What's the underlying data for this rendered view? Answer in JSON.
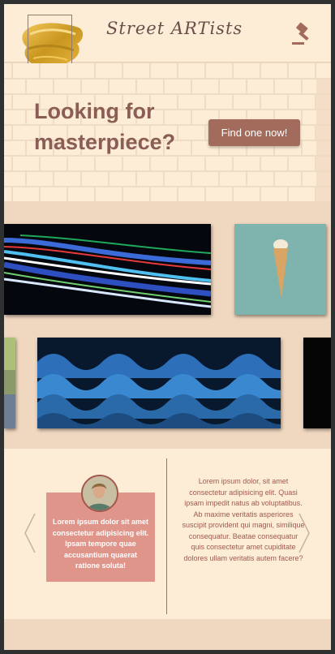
{
  "header": {
    "brand": "Street ARTists",
    "logo_icon": "paint-brush-stroke-logo",
    "action_icon": "gavel-icon"
  },
  "hero": {
    "title": "Looking for masterpiece?",
    "cta_label": "Find one now!"
  },
  "gallery": {
    "items": [
      {
        "name": "light-trails-artwork"
      },
      {
        "name": "ice-cream-cone-artwork"
      },
      {
        "name": "landscape-artwork-partial"
      },
      {
        "name": "blue-waves-artwork"
      },
      {
        "name": "dark-artwork-partial"
      }
    ]
  },
  "testimonials": {
    "prev_icon": "chevron-left-icon",
    "next_icon": "chevron-right-icon",
    "card_quote": "Lorem ipsum dolor sit amet consectetur adipisicing elit. Ipsam tempore quae accusantium quaerat ratione soluta!",
    "side_quote": "Lorem ipsum dolor, sit amet consectetur adipisicing elit. Quasi ipsam impedit natus ab voluptatibus. Ab maxime veritatis asperiores suscipit provident qui magni, similique consequatur. Beatae consequatur quis consectetur amet cupiditate dolores ullam veritatis autem facere?"
  },
  "colors": {
    "page_bg": "#f0d8c0",
    "header_bg": "#fdecd6",
    "accent": "#a36b5c",
    "card": "#e0958a",
    "text": "#8a5d55"
  }
}
